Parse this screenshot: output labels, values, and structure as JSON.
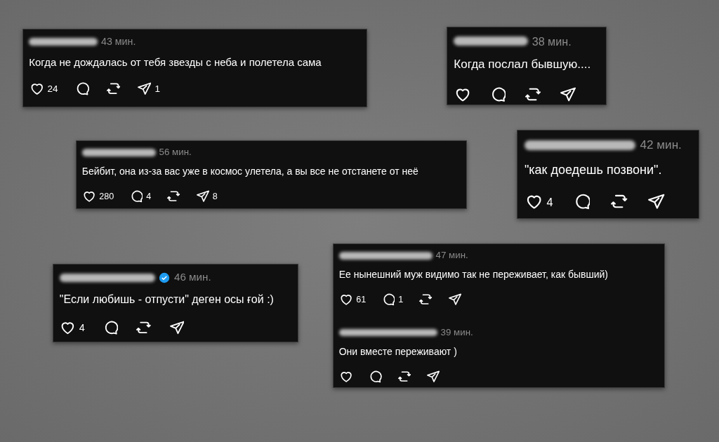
{
  "cards": [
    {
      "comments": [
        {
          "time": "43 мин.",
          "verified": false,
          "text": "Когда не дождалась от тебя звезды с неба и полетела сама",
          "likes": "24",
          "shares": "1"
        }
      ]
    },
    {
      "comments": [
        {
          "time": "38 мин.",
          "verified": false,
          "text": "Когда послал бывшую...."
        }
      ]
    },
    {
      "comments": [
        {
          "time": "56 мин.",
          "verified": false,
          "text": "Бейбит, она из-за вас уже в космос улетела, а вы все не отстанете от неё",
          "likes": "280",
          "replies": "4",
          "shares": "8"
        }
      ]
    },
    {
      "comments": [
        {
          "time": "42 мин.",
          "verified": false,
          "text": "\"как доедешь позвони\".",
          "likes": "4"
        }
      ]
    },
    {
      "comments": [
        {
          "time": "46 мин.",
          "verified": true,
          "text": "\"Если любишь - отпусти\" деген осы ғой :)",
          "likes": "4"
        }
      ]
    },
    {
      "comments": [
        {
          "time": "47 мин.",
          "verified": false,
          "text": "Ее нынешний муж видимо так не переживает, как бывший)",
          "likes": "61",
          "replies": "1"
        },
        {
          "time": "39 мин.",
          "verified": false,
          "text": "Они вместе переживают )"
        }
      ]
    }
  ]
}
